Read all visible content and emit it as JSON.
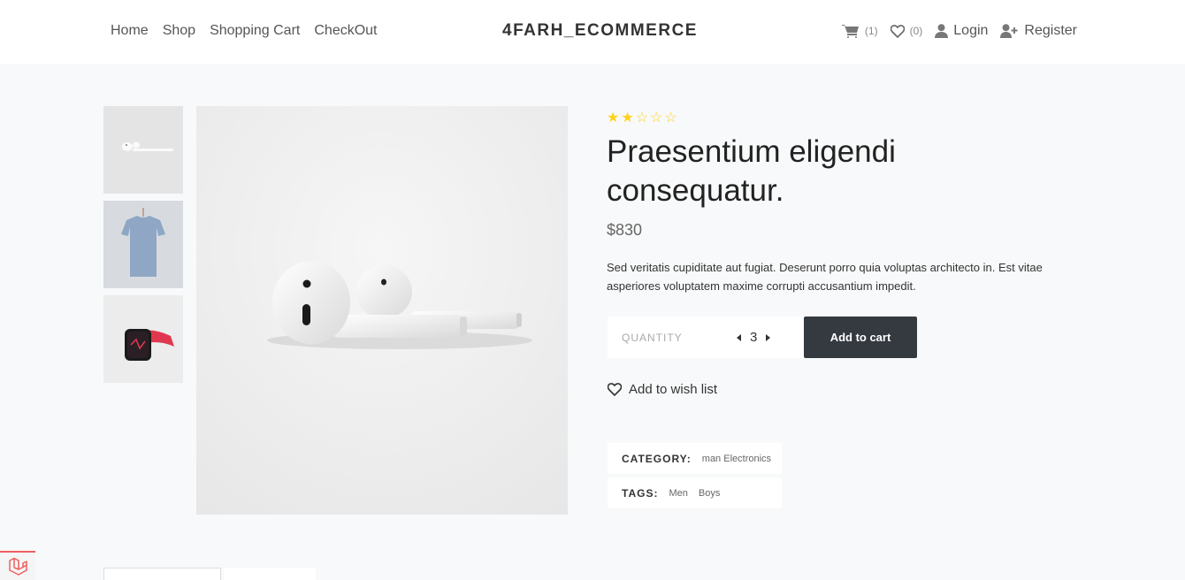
{
  "nav": {
    "links": [
      "Home",
      "Shop",
      "Shopping Cart",
      "CheckOut"
    ],
    "brand": "4FARH_ECOMMERCE",
    "cart_count": "(1)",
    "wishlist_count": "(0)",
    "login": "Login",
    "register": "Register"
  },
  "gallery": {
    "thumbnails": [
      "airpods",
      "t-shirt",
      "watch"
    ]
  },
  "product": {
    "rating": 2,
    "max_rating": 5,
    "title": "Praesentium eligendi consequatur.",
    "price": "$830",
    "description": "Sed veritatis cupiditate aut fugiat. Deserunt porro quia voluptas architecto in. Est vitae asperiores voluptatem maxime corrupti accusantium impedit.",
    "quantity_label": "QUANTITY",
    "quantity": "3",
    "add_to_cart": "Add to cart",
    "add_to_wishlist": "Add to wish list",
    "category_label": "CATEGORY:",
    "category": "man Electronics",
    "tags_label": "TAGS:",
    "tags": [
      "Men",
      "Boys"
    ]
  },
  "colors": {
    "star": "#ffd21f",
    "button_bg": "#343a40",
    "page_bg": "#f8f9fa"
  }
}
